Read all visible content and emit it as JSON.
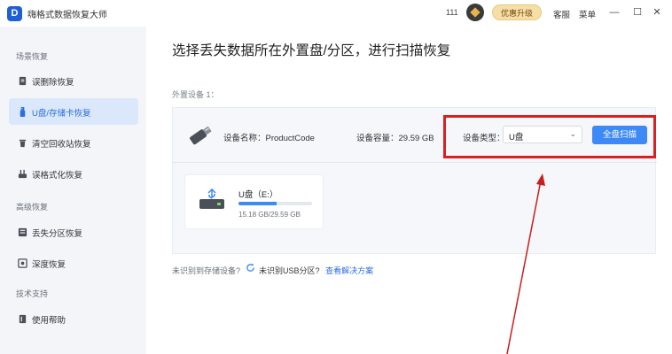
{
  "titlebar": {
    "app_title": "嗨格式数据恢复大师",
    "count": "111",
    "promo_label": "优惠升级",
    "service_label": "客服",
    "menu_label": "菜单",
    "minimize": "—",
    "maximize": "☐",
    "close": "✕"
  },
  "sidebar": {
    "groups": [
      {
        "label": "场景恢复"
      },
      {
        "label": "高级恢复"
      },
      {
        "label": "技术支持"
      }
    ],
    "items": [
      {
        "label": "误删除恢复",
        "icon": "trash-file-icon"
      },
      {
        "label": "U盘/存储卡恢复",
        "icon": "usb-drive-icon",
        "active": true
      },
      {
        "label": "清空回收站恢复",
        "icon": "recycle-bin-icon"
      },
      {
        "label": "误格式化恢复",
        "icon": "format-icon"
      },
      {
        "label": "丢失分区恢复",
        "icon": "partition-icon"
      },
      {
        "label": "深度恢复",
        "icon": "deep-scan-icon"
      },
      {
        "label": "使用帮助",
        "icon": "help-book-icon"
      }
    ]
  },
  "main": {
    "title": "选择丢失数据所在外置盘/分区，进行扫描恢复",
    "section_label": "外置设备 1：",
    "device": {
      "name_label": "设备名称：ProductCode",
      "capacity_label": "设备容量：29.59 GB",
      "type_label": "设备类型：",
      "type_value": "U盘",
      "scan_button": "全盘扫描"
    },
    "partition": {
      "name": "U盘（E:）",
      "size": "15.18 GB/29.59 GB",
      "usage_fraction": 0.513
    },
    "footer": {
      "question": "未识别到存储设备?",
      "usb_text": "未识别USB分区?",
      "link": "查看解决方案"
    }
  },
  "colors": {
    "accent": "#3d8af7",
    "highlight": "#d92020",
    "sidebar_bg": "#f3f5f9",
    "active_bg": "#dbe8fb"
  }
}
